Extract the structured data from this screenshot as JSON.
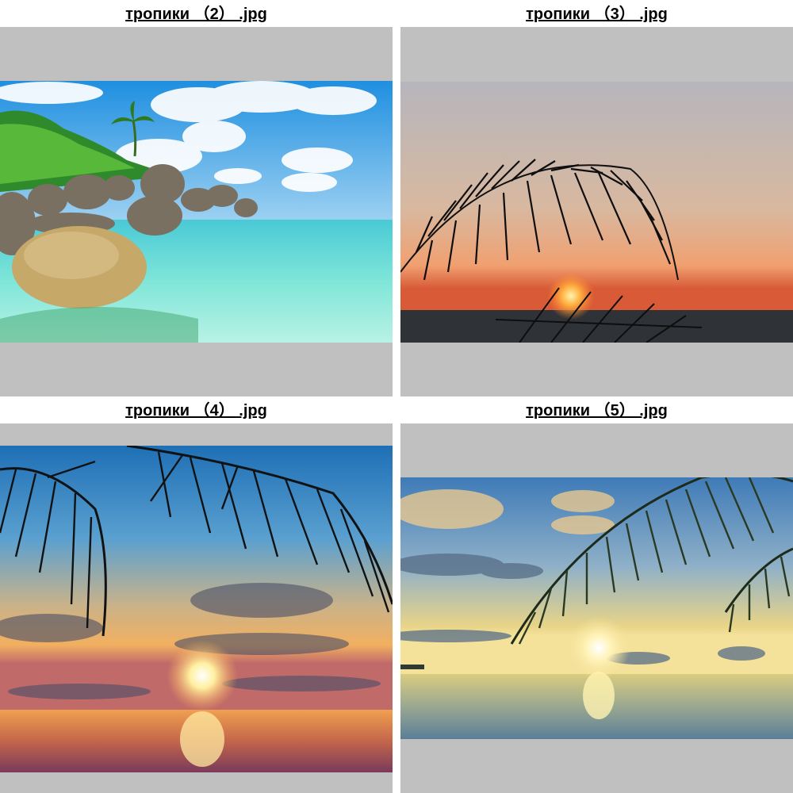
{
  "gallery": {
    "items": [
      {
        "caption": "тропики （2） .jpg",
        "subject": "rocky-tropical-beach-photo"
      },
      {
        "caption": "тропики （3） .jpg",
        "subject": "palm-silhouette-sunset-photo"
      },
      {
        "caption": "тропики （4） .jpg",
        "subject": "palm-fronds-ocean-sunset-photo"
      },
      {
        "caption": "тропики （5） .jpg",
        "subject": "palm-leaf-calm-sea-sunrise-photo"
      }
    ]
  },
  "colors": {
    "page_background": "#ffffff",
    "frame_background": "#c0c0c0",
    "caption_text": "#000000"
  }
}
